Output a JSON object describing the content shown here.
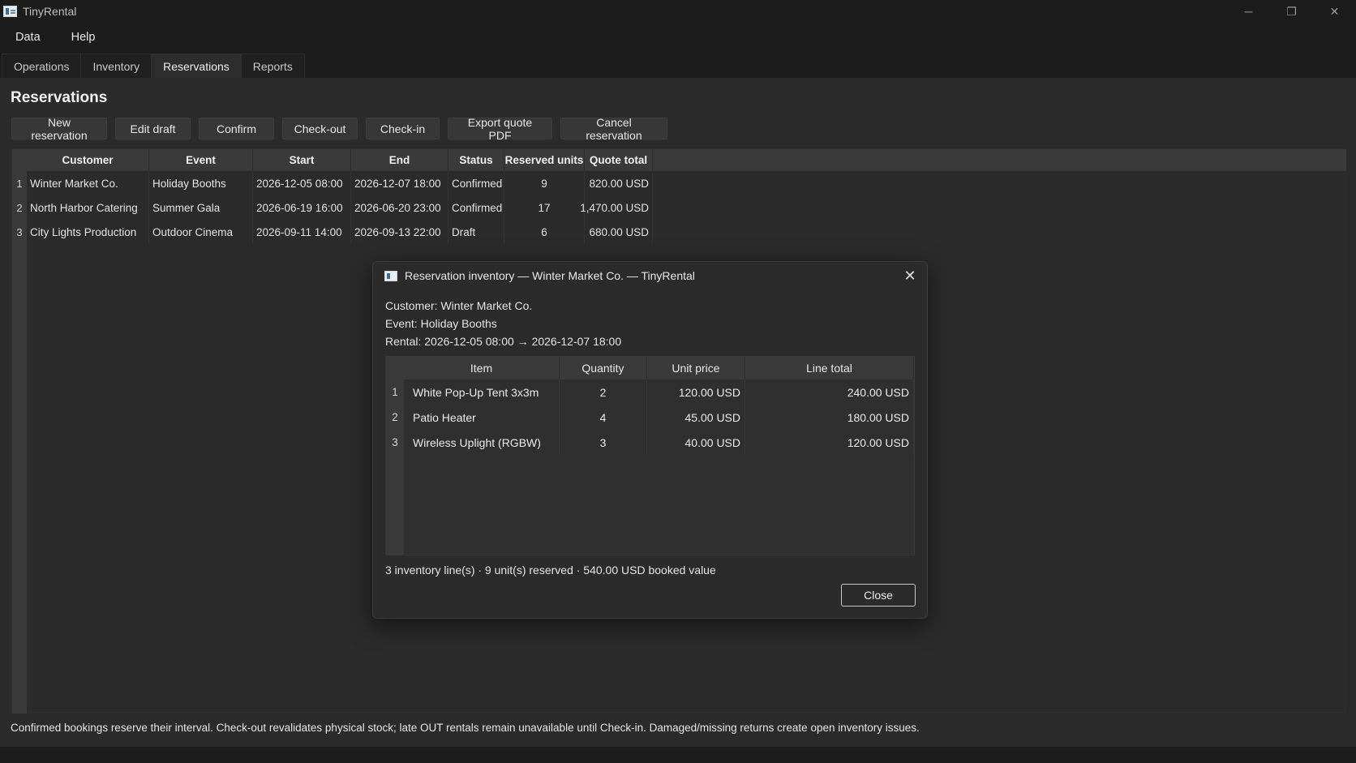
{
  "window": {
    "title": "TinyRental",
    "controls": {
      "minimize": "─",
      "restore": "❐",
      "close": "✕"
    }
  },
  "menu": [
    "Data",
    "Help"
  ],
  "tabs": [
    {
      "label": "Operations",
      "active": false
    },
    {
      "label": "Inventory",
      "active": false
    },
    {
      "label": "Reservations",
      "active": true
    },
    {
      "label": "Reports",
      "active": false
    }
  ],
  "page": {
    "title": "Reservations",
    "toolbar": [
      "New reservation",
      "Edit draft",
      "Confirm",
      "Check-out",
      "Check-in",
      "Export quote PDF",
      "Cancel reservation"
    ]
  },
  "reservations": {
    "columns": [
      "Customer",
      "Event",
      "Start",
      "End",
      "Status",
      "Reserved units",
      "Quote total"
    ],
    "rows": [
      {
        "num": "1",
        "customer": "Winter Market Co.",
        "event": "Holiday Booths",
        "start": "2026-12-05 08:00",
        "end": "2026-12-07 18:00",
        "status": "Confirmed",
        "units": "9",
        "total": "820.00 USD"
      },
      {
        "num": "2",
        "customer": "North Harbor Catering",
        "event": "Summer Gala",
        "start": "2026-06-19 16:00",
        "end": "2026-06-20 23:00",
        "status": "Confirmed",
        "units": "17",
        "total": "1,470.00 USD"
      },
      {
        "num": "3",
        "customer": "City Lights Production",
        "event": "Outdoor Cinema",
        "start": "2026-09-11 14:00",
        "end": "2026-09-13 22:00",
        "status": "Draft",
        "units": "6",
        "total": "680.00 USD"
      }
    ]
  },
  "status_line": "Confirmed bookings reserve their interval. Check-out revalidates physical stock; late OUT rentals remain unavailable until Check-in. Damaged/missing returns create open inventory issues.",
  "dialog": {
    "title": "Reservation inventory — Winter Market Co. — TinyRental",
    "close_glyph": "✕",
    "customer_line": "Customer: Winter Market Co.",
    "event_line": "Event: Holiday Booths",
    "rental_line": "Rental: 2026-12-05 08:00 → 2026-12-07 18:00",
    "columns": [
      "Item",
      "Quantity",
      "Unit price",
      "Line total"
    ],
    "rows": [
      {
        "num": "1",
        "item": "White Pop-Up Tent 3x3m",
        "qty": "2",
        "unit": "120.00 USD",
        "line": "240.00 USD"
      },
      {
        "num": "2",
        "item": "Patio Heater",
        "qty": "4",
        "unit": "45.00 USD",
        "line": "180.00 USD"
      },
      {
        "num": "3",
        "item": "Wireless Uplight (RGBW)",
        "qty": "3",
        "unit": "40.00 USD",
        "line": "120.00 USD"
      }
    ],
    "summary": "3 inventory line(s) · 9 unit(s) reserved · 540.00 USD booked value",
    "close_button": "Close"
  }
}
